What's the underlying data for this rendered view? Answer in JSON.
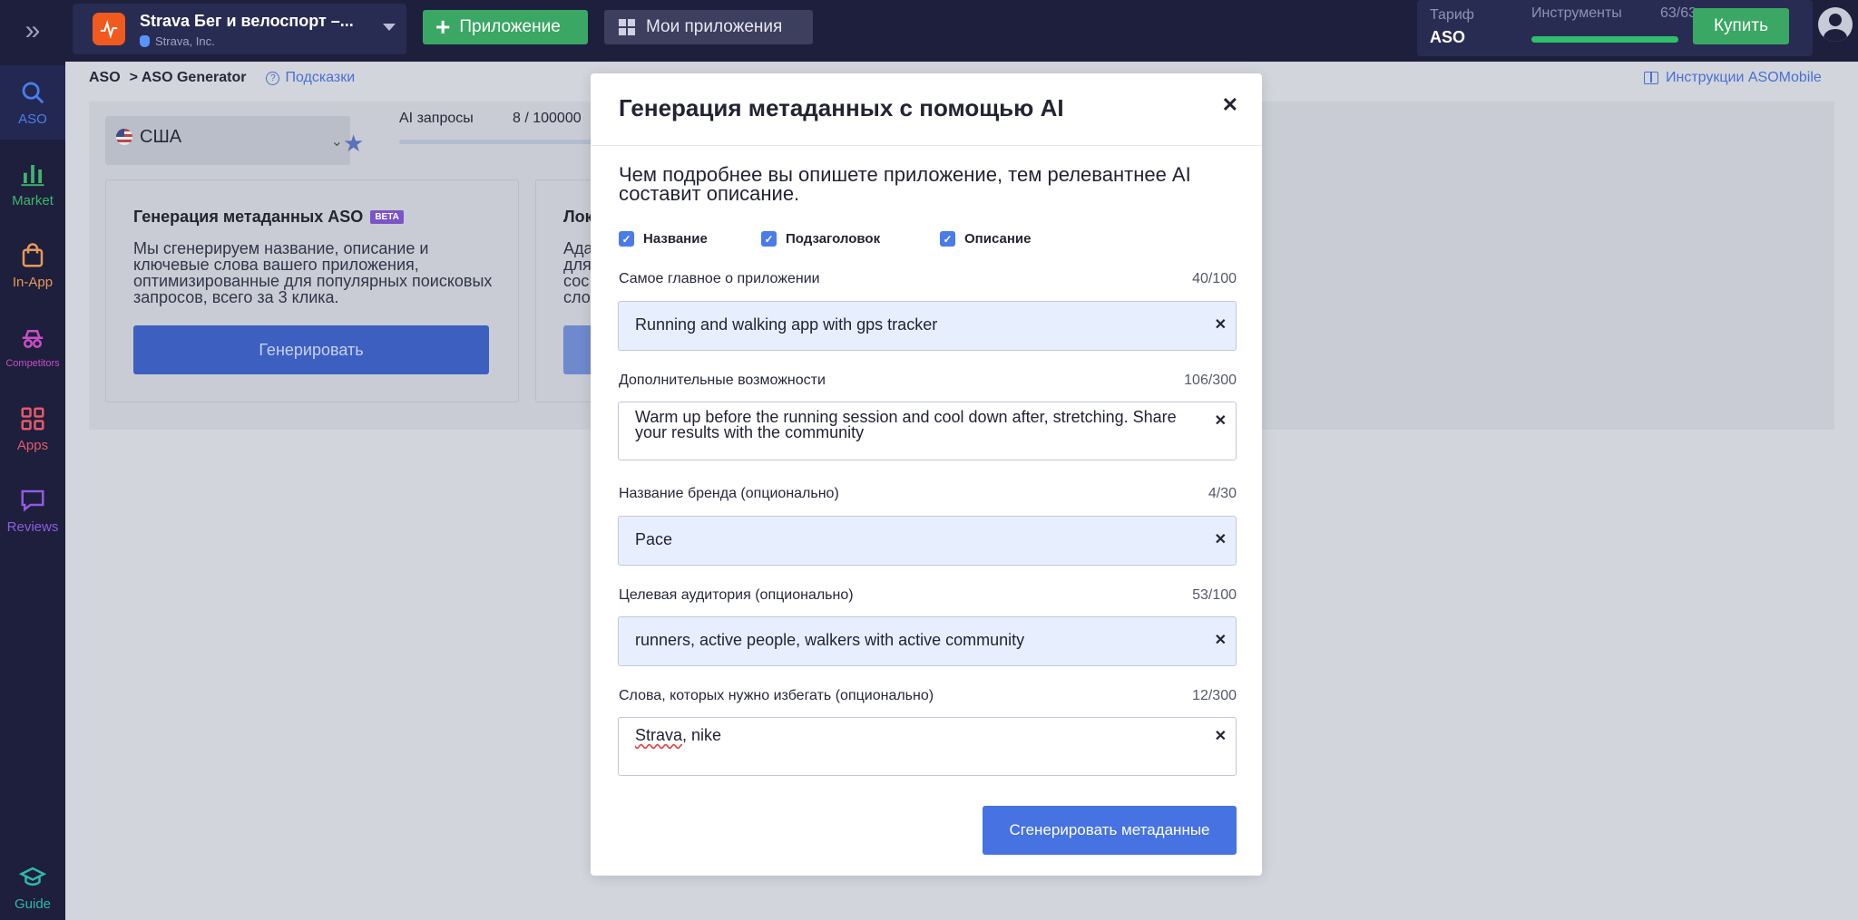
{
  "sidebar": {
    "items": [
      {
        "label": "ASO",
        "icon": "search-icon"
      },
      {
        "label": "Market",
        "icon": "bar-chart-icon"
      },
      {
        "label": "In-App",
        "icon": "shopping-bag-icon"
      },
      {
        "label": "Competitors",
        "icon": "spy-icon"
      },
      {
        "label": "Apps",
        "icon": "grid-icon"
      },
      {
        "label": "Reviews",
        "icon": "chat-icon"
      },
      {
        "label": "Guide",
        "icon": "graduation-cap-icon"
      }
    ]
  },
  "topbar": {
    "app_name": "Strava Бег и велоспорт –...",
    "app_developer": "Strava, Inc.",
    "add_app_label": "Приложение",
    "my_apps_label": "Мои приложения",
    "tariff_label": "Тариф",
    "tariff_value": "ASO",
    "tools_label": "Инструменты",
    "tools_count": "63/63",
    "tools_progress": 1.0,
    "buy_label": "Купить"
  },
  "breadcrumb": {
    "root": "ASO",
    "current": "> ASO Generator",
    "hints": "Подсказки",
    "instructions": "Инструкции ASOMobile"
  },
  "background": {
    "country": "США",
    "ai_requests_label": "AI запросы",
    "ai_requests_count": "8 / 100000",
    "card_title": "Генерация метаданных ASO",
    "card_badge": "BETA",
    "card_text": "Мы сгенерируем название, описание и ключевые слова вашего приложения, оптимизированные для популярных поисковых запросов, всего за 3 клика.",
    "card_button": "Генерировать",
    "card2_title_fragment": "Лок",
    "card2_text_fragment": "Ада для сос сло"
  },
  "modal": {
    "title": "Генерация метаданных с помощью AI",
    "intro": "Чем подробнее вы опишете приложение, тем релевантнее AI составит описание.",
    "checkboxes": [
      {
        "label": "Название",
        "checked": true
      },
      {
        "label": "Подзаголовок",
        "checked": true
      },
      {
        "label": "Описание",
        "checked": true
      }
    ],
    "fields": [
      {
        "label": "Самое главное о приложении",
        "count": "40/100",
        "value": "Running and walking app with gps tracker"
      },
      {
        "label": "Дополнительные возможности",
        "count": "106/300",
        "value": "Warm up before the running session and cool down after, stretching. Share your results with the community"
      },
      {
        "label": "Название бренда (опционально)",
        "count": "4/30",
        "value": "Pace"
      },
      {
        "label": "Целевая аудитория (опционально)",
        "count": "53/100",
        "value": "runners, active people, walkers with active community"
      },
      {
        "label": "Слова, которых нужно избегать (опционально)",
        "count": "12/300",
        "value_part1": "Strava",
        "value_part2": ", nike"
      }
    ],
    "submit_label": "Сгенерировать метаданные"
  },
  "colors": {
    "sidebar_bg": "#1d1f3c",
    "accent_green": "#3aa764",
    "accent_blue": "#4672e2",
    "field_fill": "#e7efff"
  }
}
